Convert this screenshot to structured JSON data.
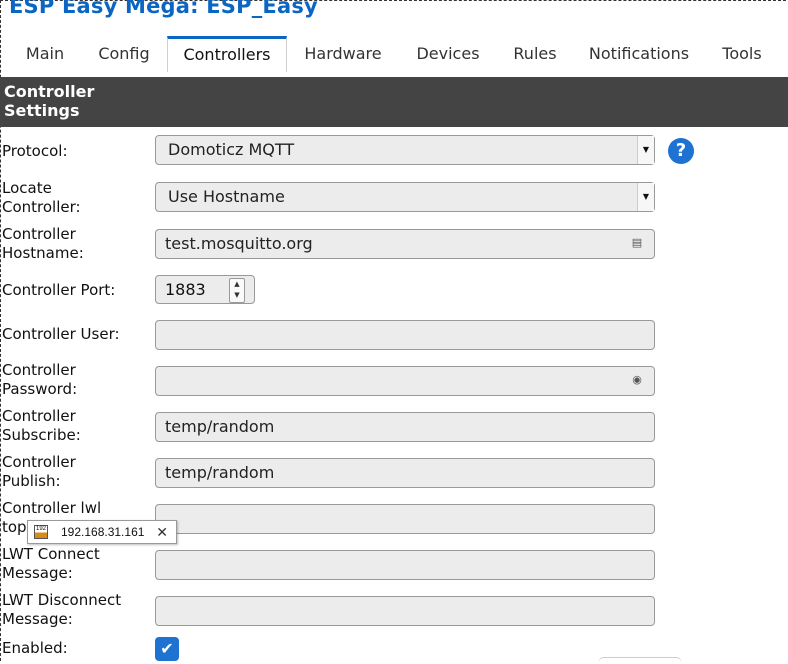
{
  "app": {
    "title": "ESP Easy Mega: ESP_Easy"
  },
  "tabs": [
    {
      "label": "Main"
    },
    {
      "label": "Config"
    },
    {
      "label": "Controllers",
      "active": true
    },
    {
      "label": "Hardware"
    },
    {
      "label": "Devices"
    },
    {
      "label": "Rules"
    },
    {
      "label": "Notifications"
    },
    {
      "label": "Tools"
    }
  ],
  "section": {
    "title_line1": "Controller",
    "title_line2": "Settings"
  },
  "form": {
    "protocol": {
      "label": "Protocol:",
      "value": "Domoticz MQTT"
    },
    "locate": {
      "label_line1": "Locate",
      "label_line2": "Controller:",
      "value": "Use Hostname"
    },
    "hostname": {
      "label_line1": "Controller",
      "label_line2": "Hostname:",
      "value": "test.mosquitto.org"
    },
    "port": {
      "label": "Controller Port:",
      "value": "1883"
    },
    "user": {
      "label": "Controller User:",
      "value": ""
    },
    "password": {
      "label_line1": "Controller",
      "label_line2": "Password:",
      "value": ""
    },
    "subscribe": {
      "label_line1": "Controller",
      "label_line2": "Subscribe:",
      "value": "temp/random"
    },
    "publish": {
      "label_line1": "Controller",
      "label_line2": "Publish:",
      "value": "temp/random"
    },
    "lwt_topic": {
      "label_line1": "Controller lwl",
      "label_line2": "top",
      "value": ""
    },
    "lwt_connect": {
      "label_line1": "LWT Connect",
      "label_line2": "Message:",
      "value": ""
    },
    "lwt_disconnect": {
      "label_line1": "LWT Disconnect",
      "label_line2": "Message:",
      "value": ""
    },
    "enabled": {
      "label": "Enabled:",
      "checked": true
    }
  },
  "tooltip": {
    "favicon_text": "192",
    "text": "192.168.31.161"
  },
  "icons": {
    "help": "question-circle-icon",
    "dropdown": "caret-down-icon",
    "address_book": "contact-card-icon",
    "password_key": "key-icon",
    "checkmark": "checkmark-icon",
    "close": "close-icon"
  },
  "colors": {
    "accent": "#1e73d2",
    "title": "#0a66c2",
    "header_bg": "#444444"
  }
}
